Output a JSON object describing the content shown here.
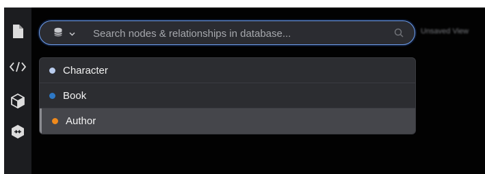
{
  "sidebar": {
    "items": [
      {
        "name": "document-icon"
      },
      {
        "name": "code-icon"
      },
      {
        "name": "cube-icon"
      },
      {
        "name": "plugin-icon"
      }
    ]
  },
  "canvas": {
    "title": "Unsaved View"
  },
  "search": {
    "placeholder": "Search nodes & relationships in database...",
    "value": "",
    "database_icon": "database-icon",
    "chevron_icon": "chevron-down-icon",
    "search_icon": "search-icon"
  },
  "dropdown": {
    "options": [
      {
        "label": "Character",
        "color": "#b9ccee",
        "selected": false
      },
      {
        "label": "Book",
        "color": "#2d78c6",
        "selected": false
      },
      {
        "label": "Author",
        "color": "#f08a1c",
        "selected": true
      }
    ]
  },
  "colors": {
    "focus_ring": "#6fa0f0",
    "app_background": "#020202",
    "rail_background": "#1c1d20"
  }
}
